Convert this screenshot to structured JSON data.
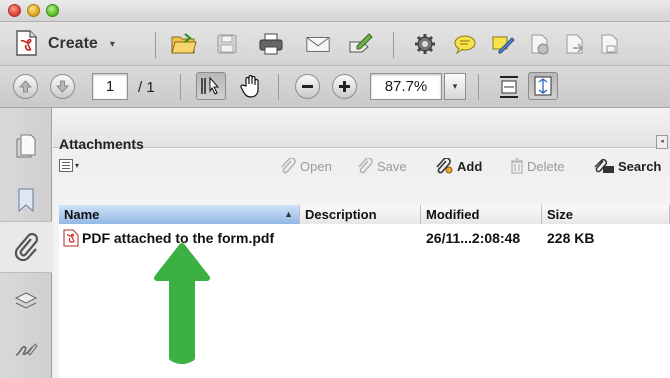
{
  "window": {
    "traffic_lights": [
      "close",
      "minimize",
      "maximize"
    ]
  },
  "toolbar": {
    "create_label": "Create",
    "create_icon": "create-pdf-icon",
    "icons": [
      "open-folder-icon",
      "save-disk-icon",
      "print-icon",
      "email-icon",
      "edit-sign-icon",
      "gear-icon",
      "comment-bubble-icon",
      "highlight-pen-icon",
      "page-stop-icon",
      "page-export-icon",
      "page-share-icon"
    ]
  },
  "nav_toolbar": {
    "page_current": "1",
    "page_total": "/ 1",
    "zoom_value": "87.7%",
    "zoom_caret": "▾"
  },
  "sidebar": {
    "items": [
      "pages-icon",
      "bookmark-icon",
      "attachment-paperclip-icon",
      "layers-icon",
      "signatures-icon"
    ],
    "active": "attachment-paperclip-icon"
  },
  "panel": {
    "title": "Attachments",
    "collapse_glyph": "◂",
    "options_caret": "▾",
    "actions": [
      {
        "label": "Open",
        "enabled": false
      },
      {
        "label": "Save",
        "enabled": false
      },
      {
        "label": "Add",
        "enabled": true
      },
      {
        "label": "Delete",
        "enabled": false
      },
      {
        "label": "Search",
        "enabled": true
      }
    ],
    "columns": [
      "Name",
      "Description",
      "Modified",
      "Size"
    ],
    "sorted_column": "Name",
    "sort_glyph": "▲",
    "rows": [
      {
        "name": "PDF attached to the form.pdf",
        "description": "",
        "modified": "26/11...2:08:48",
        "size": "228 KB"
      }
    ]
  },
  "colors": {
    "annotation_arrow": "#3cb043",
    "header_sorted": "#93b7e5",
    "pdf_red": "#d22a1e"
  }
}
